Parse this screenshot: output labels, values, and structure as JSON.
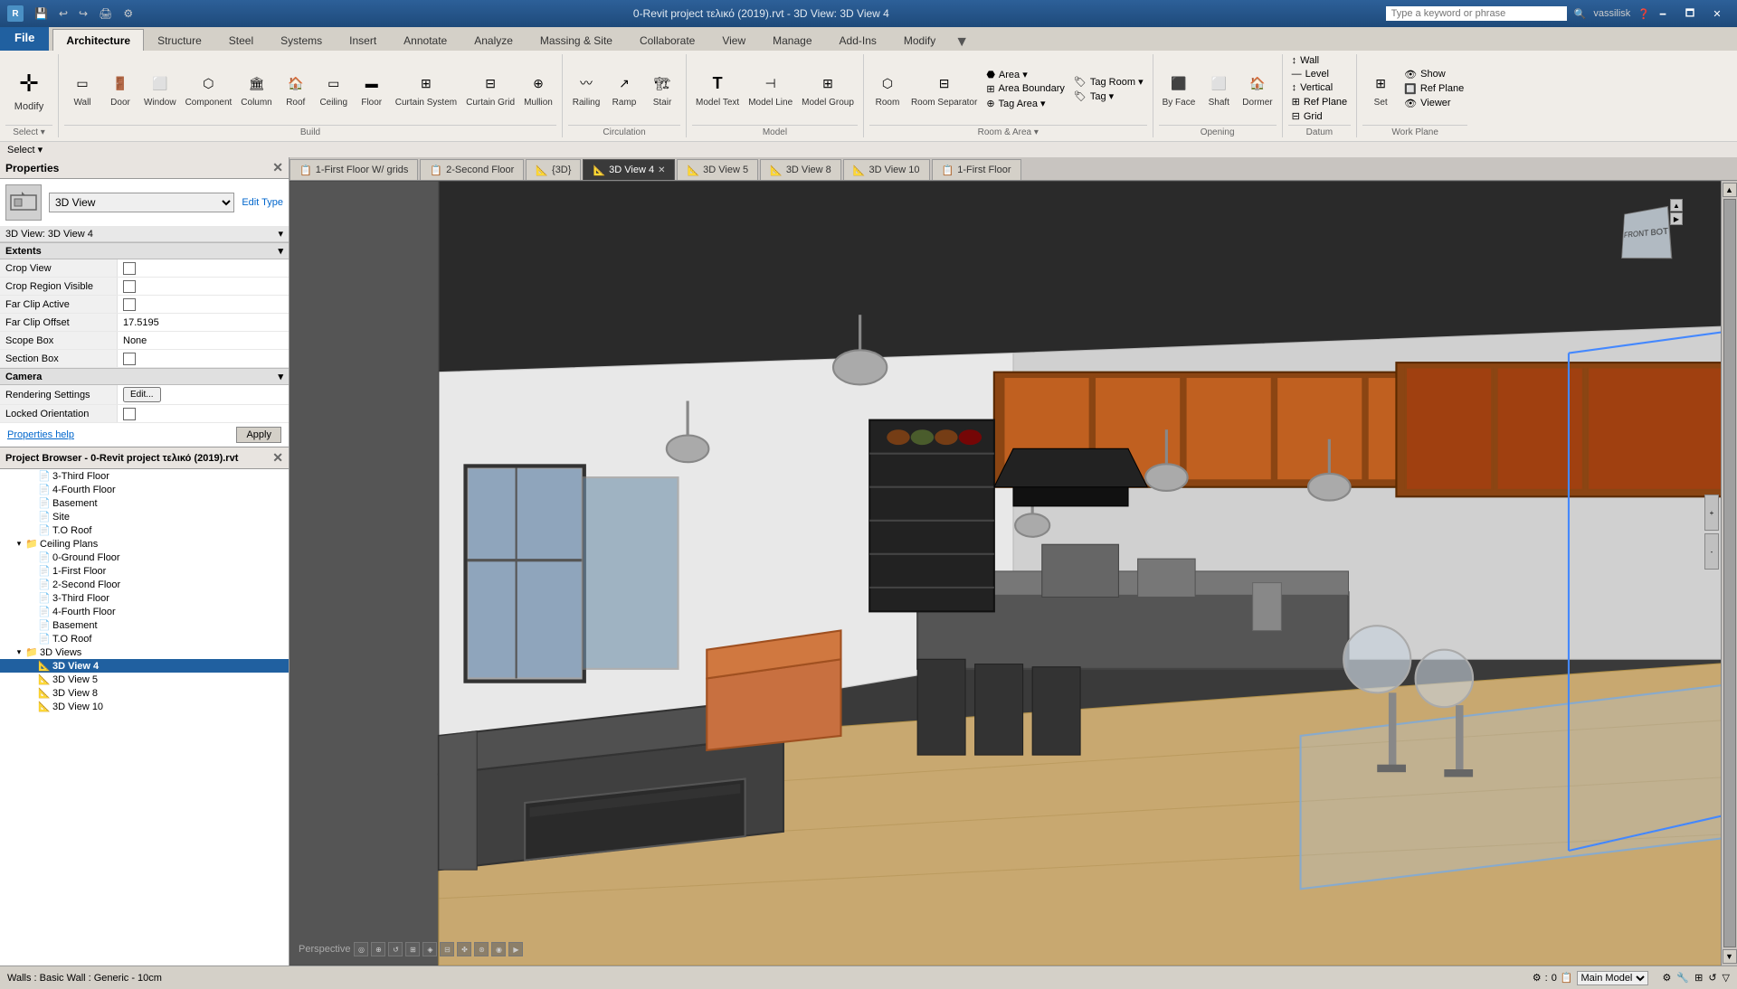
{
  "titlebar": {
    "app_icon": "R",
    "title": "0-Revit project τελικό (2019).rvt - 3D View: 3D View 4",
    "search_placeholder": "Type a keyword or phrase",
    "user": "vassilisk",
    "minimize": "🗕",
    "maximize": "🗖",
    "close": "✕"
  },
  "ribbon": {
    "file_tab": "File",
    "tabs": [
      "Architecture",
      "Structure",
      "Steel",
      "Systems",
      "Insert",
      "Annotate",
      "Analyze",
      "Massing & Site",
      "Collaborate",
      "View",
      "Manage",
      "Add-Ins",
      "Modify"
    ],
    "active_tab": "Architecture",
    "groups": {
      "select": {
        "label": "Select",
        "buttons": [
          {
            "icon": "⊹",
            "label": "Modify"
          }
        ]
      },
      "build": {
        "label": "Build",
        "buttons": [
          {
            "icon": "▭",
            "label": "Wall"
          },
          {
            "icon": "🚪",
            "label": "Door"
          },
          {
            "icon": "⬜",
            "label": "Window"
          },
          {
            "icon": "⬡",
            "label": "Component"
          },
          {
            "icon": "⬛",
            "label": "Column"
          },
          {
            "icon": "🏠",
            "label": "Roof"
          },
          {
            "icon": "▭",
            "label": "Ceiling"
          },
          {
            "icon": "▬",
            "label": "Floor"
          },
          {
            "icon": "⊞",
            "label": "Curtain System"
          },
          {
            "icon": "⊟",
            "label": "Curtain Grid"
          },
          {
            "icon": "⊕",
            "label": "Mullion"
          }
        ]
      },
      "circulation": {
        "label": "Circulation",
        "buttons": [
          {
            "icon": "〰",
            "label": "Railing"
          },
          {
            "icon": "↗",
            "label": "Ramp"
          },
          {
            "icon": "🏗",
            "label": "Stair"
          }
        ]
      },
      "model": {
        "label": "Model",
        "buttons": [
          {
            "icon": "T",
            "label": "Model Text"
          },
          {
            "icon": "⊣",
            "label": "Model Line"
          },
          {
            "icon": "⊞",
            "label": "Model Group"
          }
        ]
      },
      "room_area": {
        "label": "Room & Area",
        "buttons": [
          {
            "icon": "⬡",
            "label": "Room"
          },
          {
            "icon": "⬢",
            "label": "Room Separator"
          },
          {
            "icon": "⬣",
            "label": "Tag Room"
          },
          {
            "icon": "⊞",
            "label": "Area"
          },
          {
            "icon": "⊟",
            "label": "Area Boundary"
          },
          {
            "icon": "⊕",
            "label": "Tag Area"
          }
        ]
      },
      "opening": {
        "label": "Opening",
        "buttons": [
          {
            "icon": "⬛",
            "label": "By Face"
          },
          {
            "icon": "⬜",
            "label": "Shaft"
          },
          {
            "icon": "🔲",
            "label": "Dormer"
          }
        ]
      },
      "datum": {
        "label": "Datum",
        "buttons": [
          {
            "icon": "↕",
            "label": "Wall"
          },
          {
            "icon": "—",
            "label": "Level"
          },
          {
            "icon": "↕",
            "label": "Vertical"
          },
          {
            "icon": "⊞",
            "label": "Ref Plane"
          },
          {
            "icon": "⊟",
            "label": "Grid"
          }
        ]
      },
      "work_plane": {
        "label": "Work Plane",
        "buttons": [
          {
            "icon": "⊞",
            "label": "Set"
          },
          {
            "icon": "👁",
            "label": "Show"
          },
          {
            "icon": "🔲",
            "label": "Viewer"
          }
        ]
      }
    }
  },
  "view_tabs": [
    {
      "label": "1-First Floor  W/ grids",
      "icon": "📋",
      "active": false,
      "closeable": false
    },
    {
      "label": "2-Second Floor",
      "icon": "📋",
      "active": false,
      "closeable": false
    },
    {
      "label": "{3D}",
      "icon": "📐",
      "active": false,
      "closeable": false
    },
    {
      "label": "3D View 4",
      "icon": "📐",
      "active": true,
      "closeable": true
    },
    {
      "label": "3D View 5",
      "icon": "📐",
      "active": false,
      "closeable": false
    },
    {
      "label": "3D View 8",
      "icon": "📐",
      "active": false,
      "closeable": false
    },
    {
      "label": "3D View 10",
      "icon": "📐",
      "active": false,
      "closeable": false
    },
    {
      "label": "1-First Floor",
      "icon": "📋",
      "active": false,
      "closeable": false
    }
  ],
  "properties": {
    "title": "Properties",
    "type_icon": "📐",
    "type_name": "3D View",
    "view_label": "3D View: 3D View 4",
    "edit_type": "Edit Type",
    "sections": {
      "extents": {
        "label": "Extents",
        "fields": [
          {
            "name": "Crop View",
            "value": "",
            "type": "checkbox",
            "checked": false
          },
          {
            "name": "Crop Region Visible",
            "value": "",
            "type": "checkbox",
            "checked": false
          },
          {
            "name": "Far Clip Active",
            "value": "",
            "type": "checkbox",
            "checked": false
          },
          {
            "name": "Far Clip Offset",
            "value": "17.5195",
            "type": "text"
          },
          {
            "name": "Scope Box",
            "value": "None",
            "type": "text"
          },
          {
            "name": "Section Box",
            "value": "",
            "type": "checkbox",
            "checked": false
          }
        ]
      },
      "camera": {
        "label": "Camera",
        "fields": [
          {
            "name": "Rendering Settings",
            "value": "Edit...",
            "type": "button"
          },
          {
            "name": "Locked Orientation",
            "value": "",
            "type": "checkbox",
            "checked": false
          }
        ]
      }
    },
    "properties_help": "Properties help",
    "apply": "Apply"
  },
  "project_browser": {
    "title": "Project Browser - 0-Revit project τελικό (2019).rvt",
    "items": [
      {
        "label": "3-Third Floor",
        "level": 2,
        "type": "floor"
      },
      {
        "label": "4-Fourth Floor",
        "level": 2,
        "type": "floor"
      },
      {
        "label": "Basement",
        "level": 2,
        "type": "floor"
      },
      {
        "label": "Site",
        "level": 2,
        "type": "floor"
      },
      {
        "label": "T.O Roof",
        "level": 2,
        "type": "floor"
      },
      {
        "label": "Ceiling Plans",
        "level": 1,
        "type": "category",
        "expanded": true
      },
      {
        "label": "0-Ground Floor",
        "level": 2,
        "type": "ceiling"
      },
      {
        "label": "1-First Floor",
        "level": 2,
        "type": "ceiling"
      },
      {
        "label": "2-Second Floor",
        "level": 2,
        "type": "ceiling"
      },
      {
        "label": "3-Third Floor",
        "level": 2,
        "type": "ceiling"
      },
      {
        "label": "4-Fourth Floor",
        "level": 2,
        "type": "ceiling"
      },
      {
        "label": "Basement",
        "level": 2,
        "type": "ceiling"
      },
      {
        "label": "T.O Roof",
        "level": 2,
        "type": "ceiling"
      },
      {
        "label": "3D Views",
        "level": 1,
        "type": "category",
        "expanded": true
      },
      {
        "label": "3D View 4",
        "level": 2,
        "type": "3dview",
        "selected": true
      },
      {
        "label": "3D View 5",
        "level": 2,
        "type": "3dview"
      },
      {
        "label": "3D View 8",
        "level": 2,
        "type": "3dview"
      },
      {
        "label": "3D View 10",
        "level": 2,
        "type": "3dview"
      }
    ]
  },
  "status_bar": {
    "message": "Walls : Basic Wall : Generic - 10cm",
    "model": "Main Model",
    "zoom": "0"
  },
  "viewport": {
    "nav_cube_label": "FRONT BOT",
    "perspective_label": "Perspective"
  }
}
